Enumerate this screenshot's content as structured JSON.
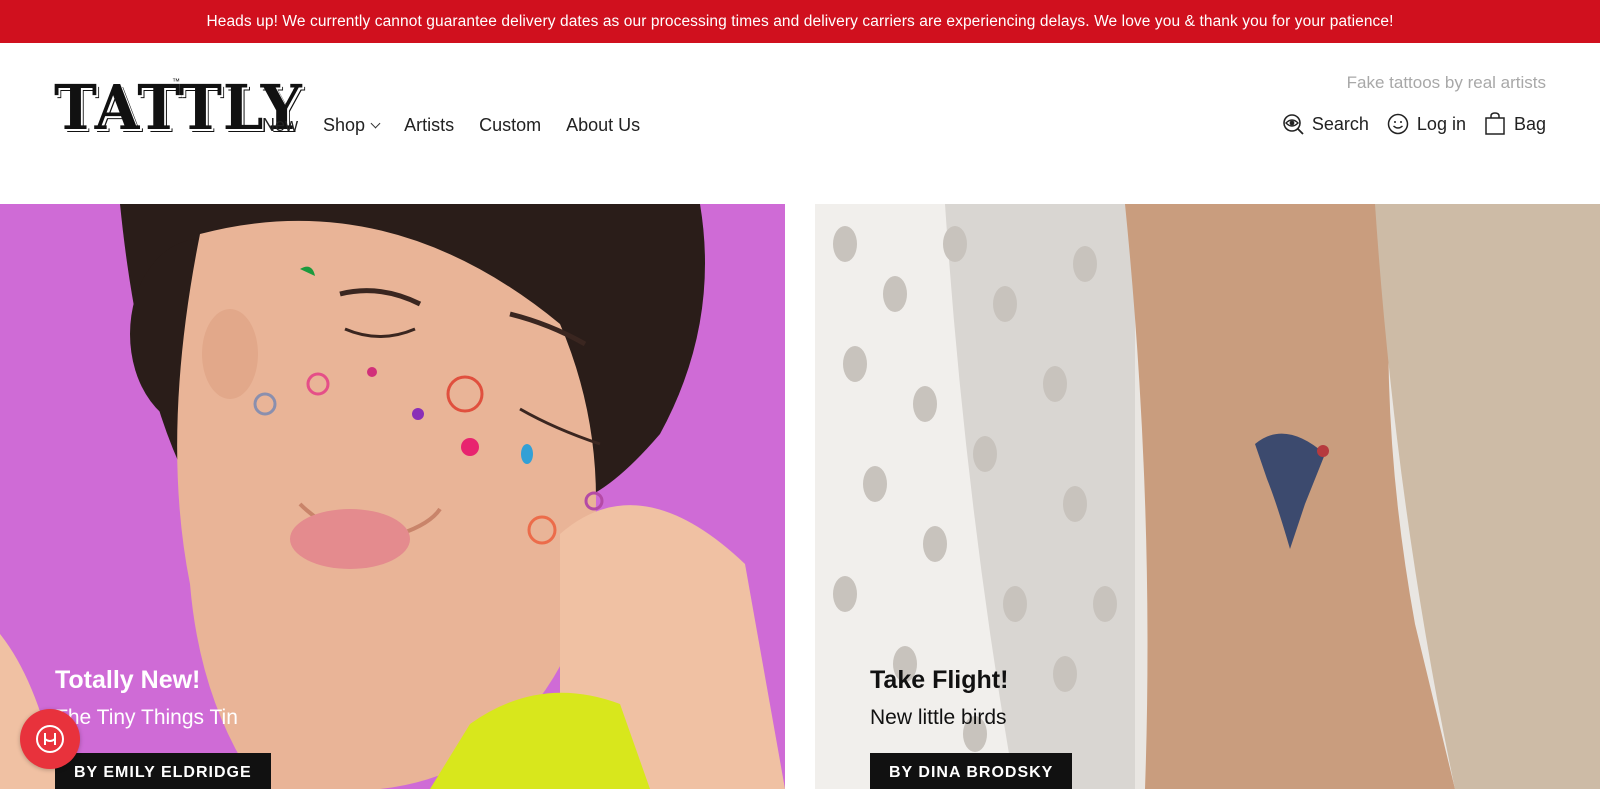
{
  "announcement": "Heads up! We currently cannot guarantee delivery dates as our processing times and delivery carriers are experiencing delays. We love you & thank you for your patience!",
  "brand": {
    "logo": "TATTLY",
    "trademark": "™",
    "tagline": "Fake tattoos by real artists"
  },
  "nav": [
    {
      "label": "New"
    },
    {
      "label": "Shop"
    },
    {
      "label": "Artists"
    },
    {
      "label": "Custom"
    },
    {
      "label": "About Us"
    }
  ],
  "utilities": {
    "search": "Search",
    "login": "Log in",
    "bag": "Bag"
  },
  "heroes": [
    {
      "title": "Totally New!",
      "subtitle": "The Tiny Things Tin",
      "button": "BY EMILY ELDRIDGE"
    },
    {
      "title": "Take Flight!",
      "subtitle": "New little birds",
      "button": "BY DINA BRODSKY"
    }
  ],
  "colors": {
    "announcement_bg": "#d0101e",
    "left_panel_bg": "#cf6bd6",
    "chat_button": "#e8323c"
  },
  "icons": {
    "search": "eye-search-icon",
    "login": "smiley-icon",
    "bag": "shopping-bag-icon",
    "shop_menu": "chevron-down-icon",
    "chat": "chat-icon"
  }
}
